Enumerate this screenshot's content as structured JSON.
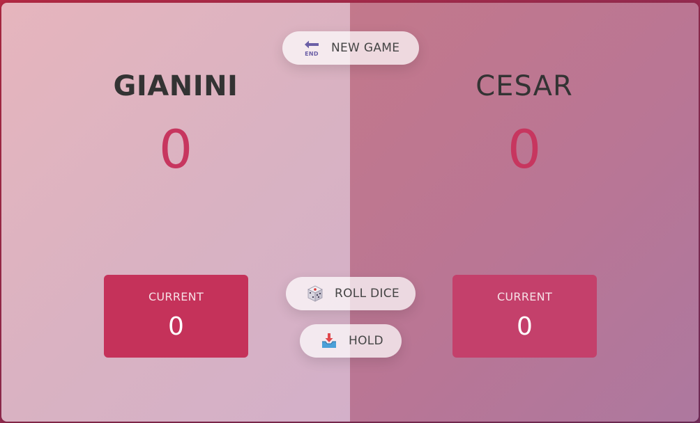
{
  "players": [
    {
      "name": "GIANINI",
      "score": "0",
      "current_label": "CURRENT",
      "current_score": "0"
    },
    {
      "name": "CESAR",
      "score": "0",
      "current_label": "CURRENT",
      "current_score": "0"
    }
  ],
  "controls": {
    "new_game": {
      "label": "NEW GAME",
      "icon": "end-arrow-icon",
      "icon_text": "END"
    },
    "roll_dice": {
      "label": "ROLL DICE",
      "icon": "dice-icon"
    },
    "hold": {
      "label": "HOLD",
      "icon": "inbox-tray-icon"
    }
  },
  "colors": {
    "score": "#c7365f",
    "current_box_left": "#c5325a",
    "current_box_right": "#c4406b"
  }
}
